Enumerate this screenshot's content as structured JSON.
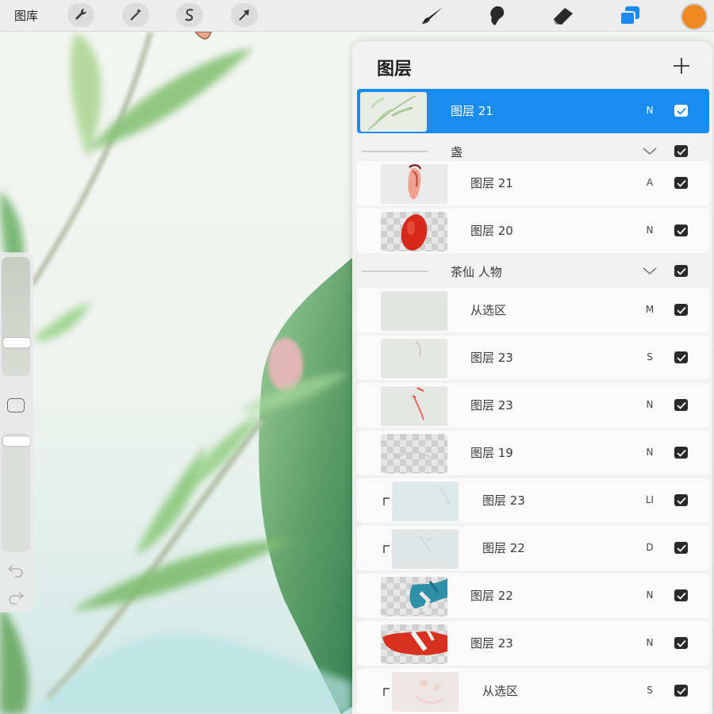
{
  "toolbar": {
    "gallery_label": "图库",
    "actions_icon": "wrench-icon",
    "adjustments_icon": "magic-wand-icon",
    "selection_icon": "selection-s-icon",
    "transform_icon": "arrow-cursor-icon",
    "brush_icon": "brush-icon",
    "smudge_icon": "smudge-icon",
    "eraser_icon": "eraser-icon",
    "layers_icon": "layers-icon",
    "active_color": "#f0891f"
  },
  "layers_panel": {
    "title": "图层",
    "add_icon": "plus-icon",
    "selected_color": "#1a8cf0",
    "rows": [
      {
        "kind": "layer",
        "name": "图层 21",
        "blend": "N",
        "visible": true,
        "selected": true
      },
      {
        "kind": "group",
        "name": "盏",
        "visible": true
      },
      {
        "kind": "layer",
        "name": "图层 21",
        "blend": "A",
        "visible": true
      },
      {
        "kind": "layer",
        "name": "图层 20",
        "blend": "N",
        "visible": true
      },
      {
        "kind": "group",
        "name": "茶仙 人物",
        "visible": true
      },
      {
        "kind": "layer",
        "name": "从选区",
        "blend": "M",
        "visible": true
      },
      {
        "kind": "layer",
        "name": "图层 23",
        "blend": "S",
        "visible": true
      },
      {
        "kind": "layer",
        "name": "图层 23",
        "blend": "N",
        "visible": true
      },
      {
        "kind": "layer",
        "name": "图层 19",
        "blend": "N",
        "visible": true
      },
      {
        "kind": "layer",
        "name": "图层 23",
        "blend": "LI",
        "visible": true,
        "clipped": true
      },
      {
        "kind": "layer",
        "name": "图层 22",
        "blend": "D",
        "visible": true,
        "clipped": true
      },
      {
        "kind": "layer",
        "name": "图层 22",
        "blend": "N",
        "visible": true
      },
      {
        "kind": "layer",
        "name": "图层 23",
        "blend": "N",
        "visible": true
      },
      {
        "kind": "layer",
        "name": "从选区",
        "blend": "S",
        "visible": true,
        "clipped": true
      }
    ]
  }
}
